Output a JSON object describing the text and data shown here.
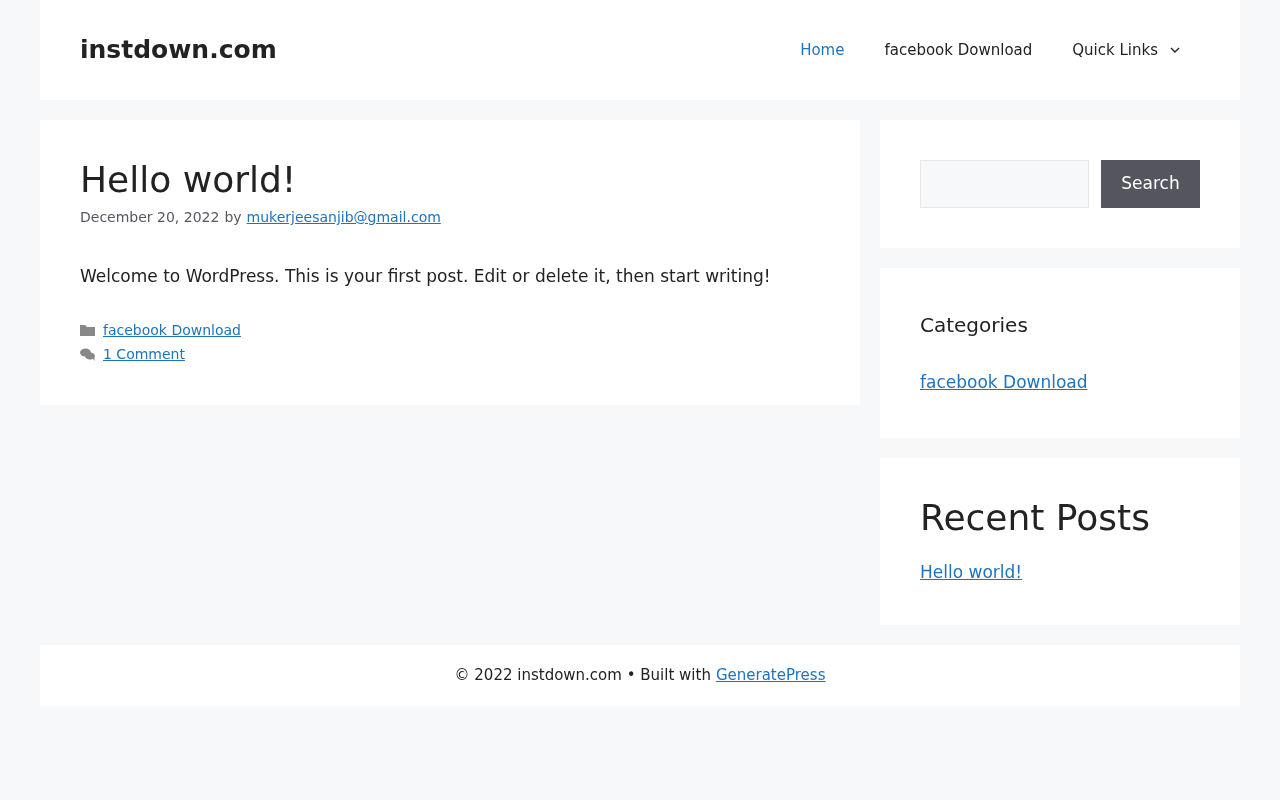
{
  "header": {
    "site_title": "instdown.com",
    "nav": [
      {
        "label": "Home",
        "selected": true,
        "has_dropdown": false
      },
      {
        "label": "facebook Download",
        "selected": false,
        "has_dropdown": false
      },
      {
        "label": "Quick Links",
        "selected": false,
        "has_dropdown": true
      }
    ]
  },
  "post": {
    "title": "Hello world!",
    "date": "December 20, 2022",
    "by": "by",
    "author": "mukerjeesanjib@gmail.com",
    "body": "Welcome to WordPress. This is your first post. Edit or delete it, then start writing!",
    "category": "facebook Download",
    "comments": "1 Comment"
  },
  "sidebar": {
    "search_button": "Search",
    "categories": {
      "title": "Categories",
      "items": [
        "facebook Download"
      ]
    },
    "recent_posts": {
      "title": "Recent Posts",
      "items": [
        "Hello world!"
      ]
    }
  },
  "footer": {
    "text": "© 2022 instdown.com • Built with",
    "link": "GeneratePress"
  }
}
